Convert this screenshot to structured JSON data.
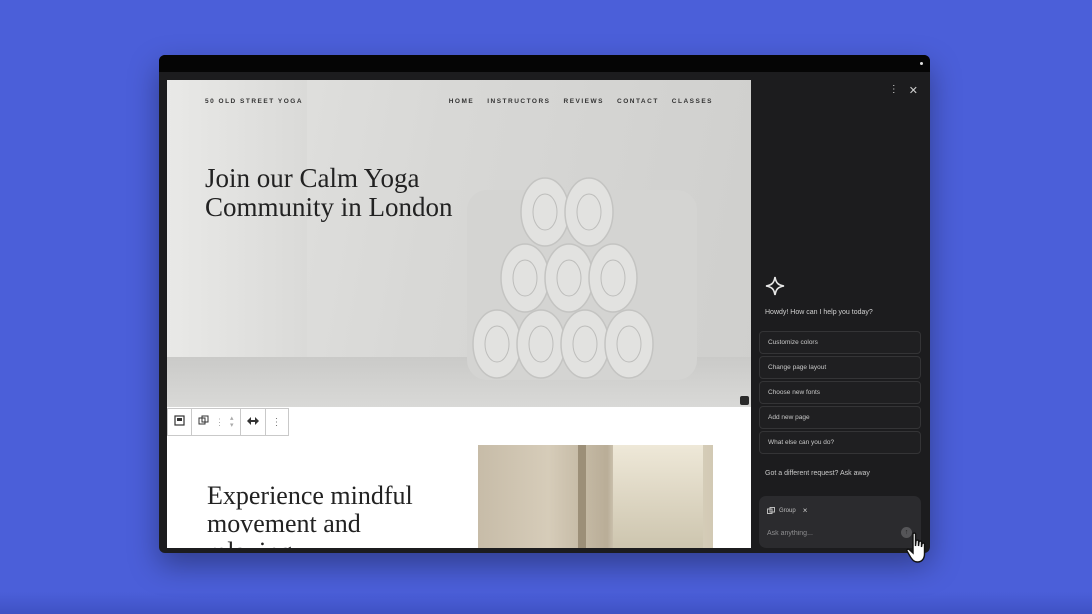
{
  "site": {
    "name": "50 OLD STREET YOGA",
    "nav": [
      "HOME",
      "INSTRUCTORS",
      "REVIEWS",
      "CONTACT",
      "CLASSES"
    ],
    "hero_title_line1": "Join our Calm Yoga",
    "hero_title_line2": "Community in London",
    "section2_title_line1": "Experience mindful",
    "section2_title_line2": "movement and",
    "section2_title_line3": "relaxing"
  },
  "assistant": {
    "greeting": "Howdy! How can I help you today?",
    "suggestions": [
      "Customize colors",
      "Change page layout",
      "Choose new fonts",
      "Add new page",
      "What else can you do?"
    ],
    "different_request": "Got a different request? Ask away",
    "context_chip": "Group",
    "input_placeholder": "Ask anything..."
  },
  "colors": {
    "background": "#4b5fd9",
    "panel": "#1c1c1e"
  }
}
